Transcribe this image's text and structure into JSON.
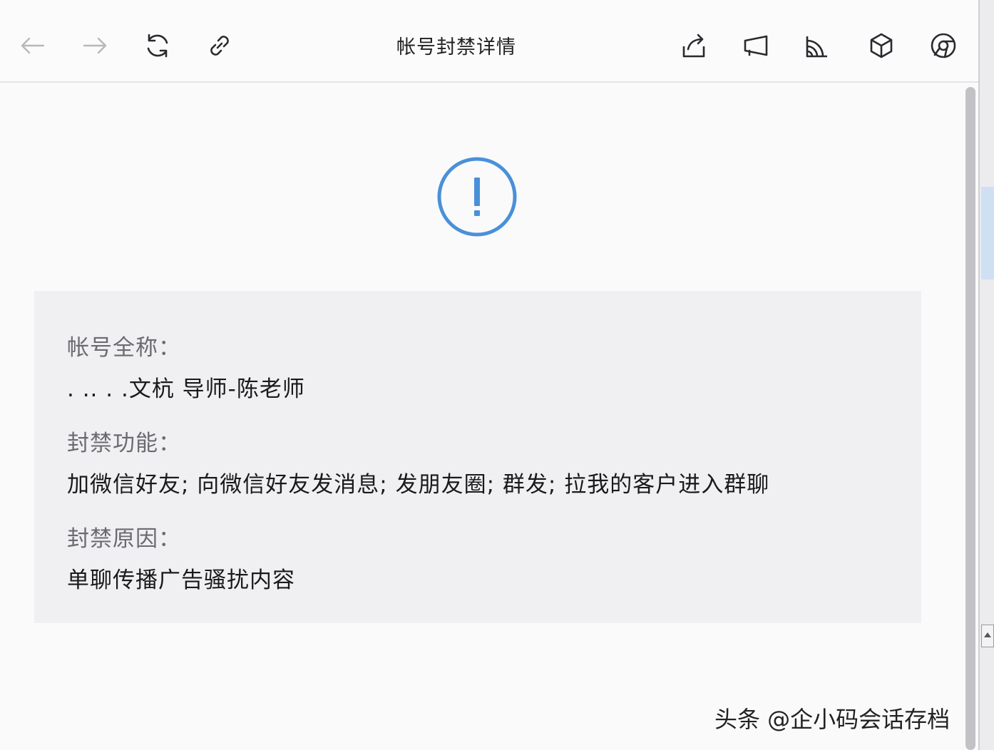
{
  "toolbar": {
    "title": "帐号封禁详情",
    "buttons": [
      {
        "name": "back-button",
        "icon": "arrow-left-icon"
      },
      {
        "name": "forward-button",
        "icon": "arrow-right-icon"
      },
      {
        "name": "refresh-button",
        "icon": "refresh-icon"
      },
      {
        "name": "copy-link-button",
        "icon": "link-icon"
      },
      {
        "name": "share-button",
        "icon": "share-icon"
      },
      {
        "name": "cast-button",
        "icon": "megaphone-icon"
      },
      {
        "name": "rss-button",
        "icon": "rss-icon"
      },
      {
        "name": "package-button",
        "icon": "cube-icon"
      },
      {
        "name": "open-in-browser-button",
        "icon": "chrome-icon"
      }
    ]
  },
  "status_icon": "exclamation-circle-icon",
  "accent_color": "#4a90d9",
  "details": {
    "account_name_label": "帐号全称：",
    "account_name_value": ". .. . .文杭    导师-陈老师",
    "banned_features_label": "封禁功能：",
    "banned_features_value": "加微信好友; 向微信好友发消息; 发朋友圈; 群发; 拉我的客户进入群聊",
    "ban_reason_label": "封禁原因：",
    "ban_reason_value": "单聊传播广告骚扰内容"
  },
  "watermark": "头条 @企小码会话存档"
}
